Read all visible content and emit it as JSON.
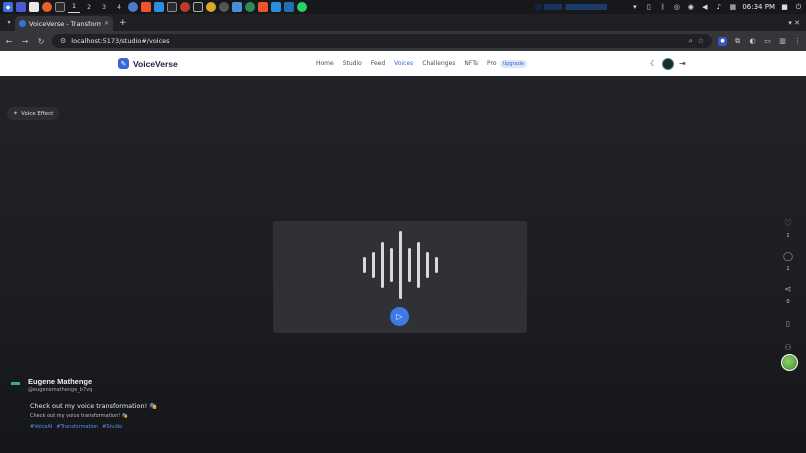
{
  "taskbar": {
    "workspaces": [
      "1",
      "2",
      "3",
      "4"
    ],
    "active_workspace": "1",
    "clock": "06:34 PM"
  },
  "browser": {
    "tab_title": "VoiceVerse - Transform",
    "url": "localhost:5173/studio#/voices"
  },
  "app": {
    "brand": "VoiceVerse",
    "brand_color": "#3567d6",
    "nav": [
      "Home",
      "Studio",
      "Feed",
      "Voices",
      "Challenges",
      "NFTs",
      "Pro"
    ],
    "active_nav": "Voices",
    "upgrade_badge": "Upgrade"
  },
  "feed": {
    "voice_effect_label": "Voice Effect",
    "waveform_levels": [
      0.22,
      0.35,
      0.62,
      0.45,
      0.92,
      0.45,
      0.62,
      0.35,
      0.22
    ],
    "play_button_color": "#3d7be3",
    "actions": {
      "likes": "1",
      "comments": "1",
      "shares": "0"
    },
    "post": {
      "author_name": "Eugene Mathenge",
      "author_handle": "@eugenemathenge_b7vq",
      "title": "Check out my voice transformation! 🎭",
      "description": "Check out my voice transformation! 🎭",
      "tags": [
        "#VoiceAI",
        "#Transformation",
        "#Studio"
      ],
      "tag_color": "#5b8de6"
    }
  }
}
